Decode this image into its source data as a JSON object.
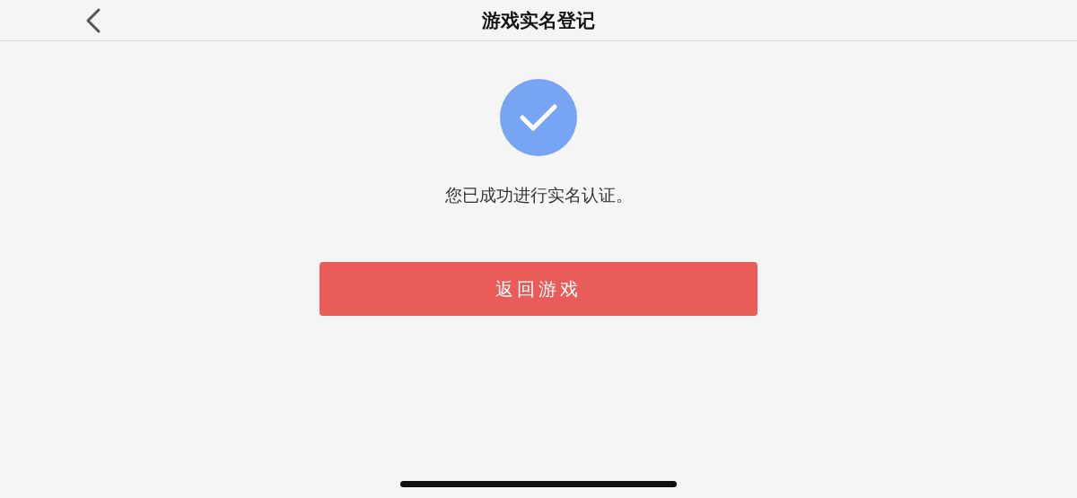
{
  "header": {
    "title": "游戏实名登记"
  },
  "result": {
    "message": "您已成功进行实名认证。"
  },
  "buttons": [
    {
      "label": "返回游戏"
    }
  ]
}
